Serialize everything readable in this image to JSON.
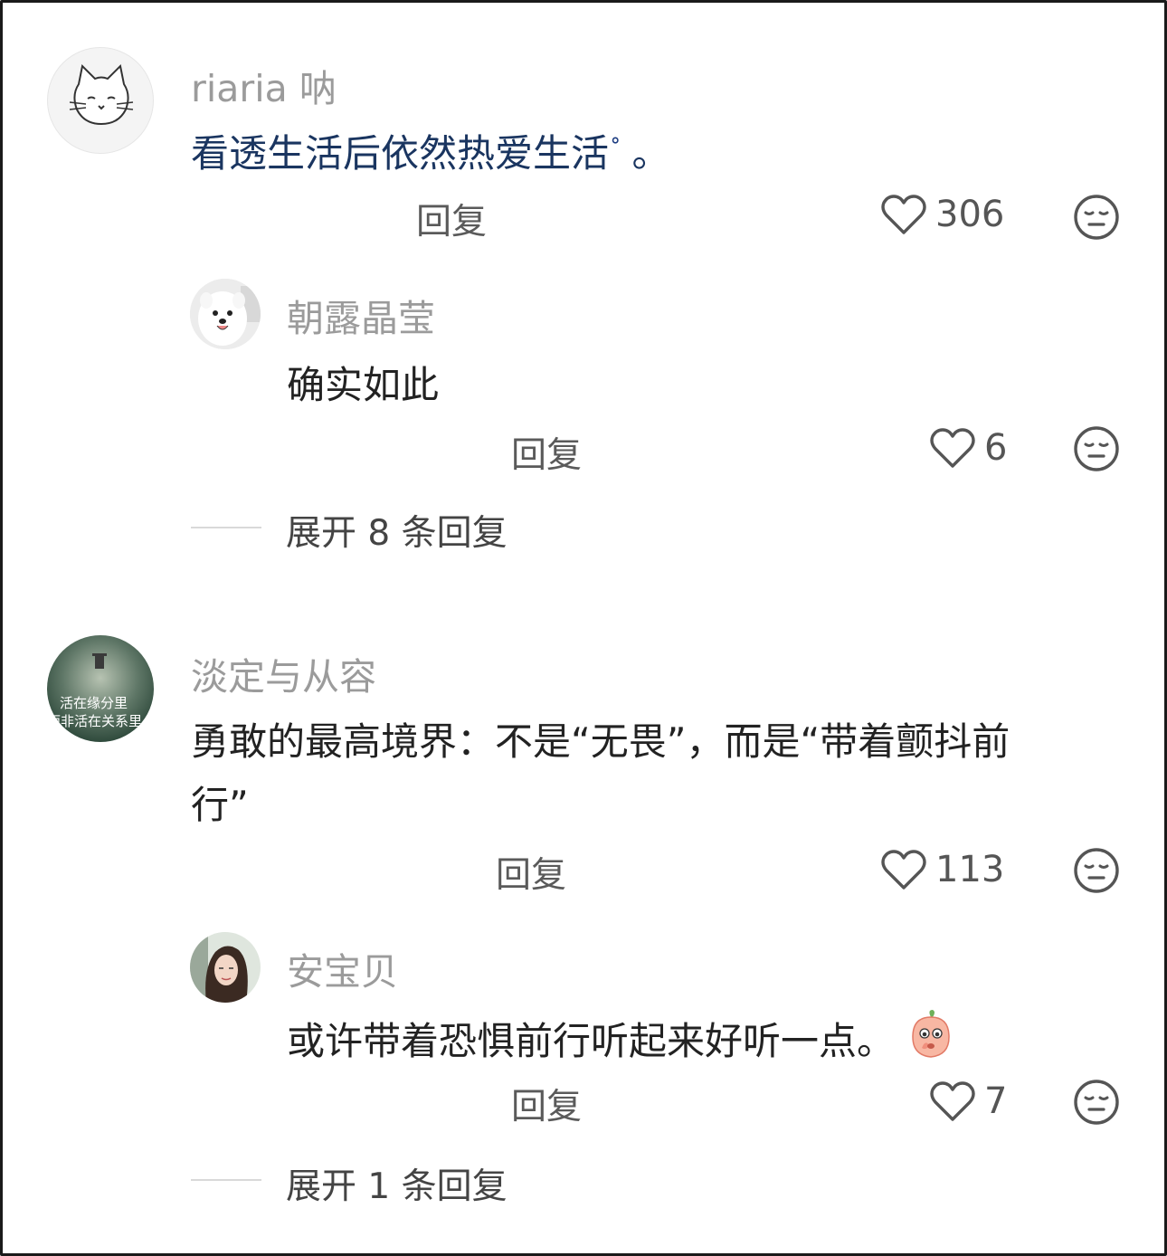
{
  "comments": [
    {
      "user": "riaria 呐",
      "text": "看透生活后依然热爱生活",
      "search_mark": "ᐤ",
      "text_suffix": " 。",
      "reply_label": "回复",
      "likes": "306",
      "replies": [
        {
          "user": "朝露晶莹",
          "text": "确实如此",
          "reply_label": "回复",
          "likes": "6"
        }
      ],
      "expand_label": "展开 8 条回复"
    },
    {
      "user": "淡定与从容",
      "avatar_text_line1": "活在缘分里",
      "avatar_text_line2": "而非活在关系里",
      "text_line1": "勇敢的最高境界：不是“无畏”，而是“带着颤抖前",
      "text_line2": "行”",
      "reply_label": "回复",
      "likes": "113",
      "replies": [
        {
          "user": "安宝贝",
          "text": "或许带着恐惧前行听起来好听一点。",
          "reply_label": "回复",
          "likes": "7"
        }
      ],
      "expand_label": "展开 1 条回复"
    }
  ],
  "icons": {
    "like": "heart-outline-icon",
    "dislike": "neutral-face-icon",
    "emoji": "peach-shy-emoji"
  },
  "colors": {
    "username": "#9b9b9b",
    "text": "#222222",
    "highlight_text": "#1a3560",
    "icon": "#555555"
  }
}
